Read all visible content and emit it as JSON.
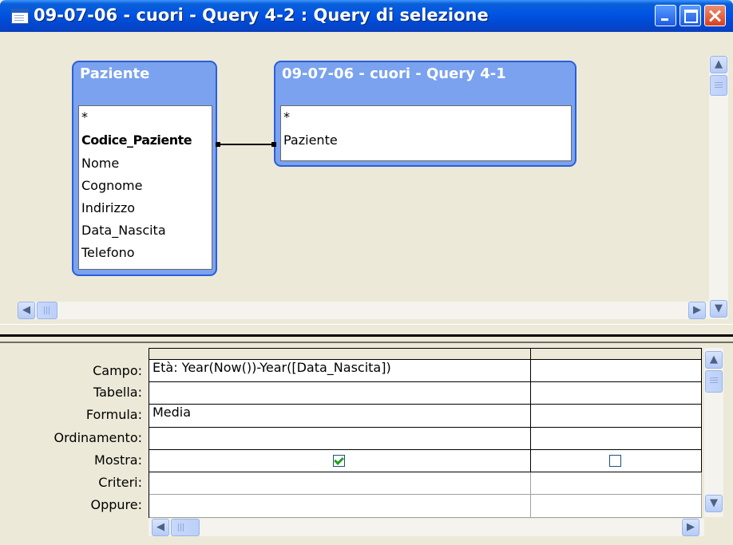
{
  "window": {
    "title": "09-07-06 - cuori - Query 4-2 : Query di selezione"
  },
  "tables": [
    {
      "name": "Paziente",
      "fields": [
        "*",
        "Codice_Paziente",
        "Nome",
        "Cognome",
        "Indirizzo",
        "Data_Nascita",
        "Telefono"
      ],
      "key_field": "Codice_Paziente"
    },
    {
      "name": "09-07-06 - cuori - Query 4-1",
      "fields": [
        "*",
        "Paziente"
      ]
    }
  ],
  "grid": {
    "row_labels": [
      "Campo:",
      "Tabella:",
      "Formula:",
      "Ordinamento:",
      "Mostra:",
      "Criteri:",
      "Oppure:"
    ],
    "columns": [
      {
        "campo": "Età: Year(Now())-Year([Data_Nascita])",
        "tabella": "",
        "formula": "Media",
        "ordinamento": "",
        "mostra": true,
        "criteri": "",
        "oppure": ""
      },
      {
        "campo": "",
        "tabella": "",
        "formula": "",
        "ordinamento": "",
        "mostra": false,
        "criteri": "",
        "oppure": ""
      }
    ]
  },
  "icons": {
    "title": "query-icon",
    "scroll_up": "▲",
    "scroll_down": "▼",
    "scroll_left": "◀",
    "scroll_right": "▶"
  },
  "colors": {
    "titlebar": "#0054e3",
    "table_header": "#7aa2ef",
    "pane_bg": "#ece9d8"
  }
}
